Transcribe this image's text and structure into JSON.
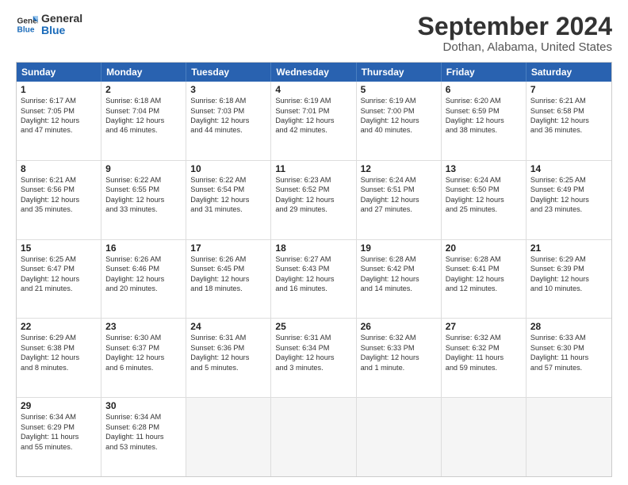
{
  "logo": {
    "line1": "General",
    "line2": "Blue"
  },
  "title": "September 2024",
  "subtitle": "Dothan, Alabama, United States",
  "days_of_week": [
    "Sunday",
    "Monday",
    "Tuesday",
    "Wednesday",
    "Thursday",
    "Friday",
    "Saturday"
  ],
  "weeks": [
    [
      {
        "num": "1",
        "lines": [
          "Sunrise: 6:17 AM",
          "Sunset: 7:05 PM",
          "Daylight: 12 hours",
          "and 47 minutes."
        ]
      },
      {
        "num": "2",
        "lines": [
          "Sunrise: 6:18 AM",
          "Sunset: 7:04 PM",
          "Daylight: 12 hours",
          "and 46 minutes."
        ]
      },
      {
        "num": "3",
        "lines": [
          "Sunrise: 6:18 AM",
          "Sunset: 7:03 PM",
          "Daylight: 12 hours",
          "and 44 minutes."
        ]
      },
      {
        "num": "4",
        "lines": [
          "Sunrise: 6:19 AM",
          "Sunset: 7:01 PM",
          "Daylight: 12 hours",
          "and 42 minutes."
        ]
      },
      {
        "num": "5",
        "lines": [
          "Sunrise: 6:19 AM",
          "Sunset: 7:00 PM",
          "Daylight: 12 hours",
          "and 40 minutes."
        ]
      },
      {
        "num": "6",
        "lines": [
          "Sunrise: 6:20 AM",
          "Sunset: 6:59 PM",
          "Daylight: 12 hours",
          "and 38 minutes."
        ]
      },
      {
        "num": "7",
        "lines": [
          "Sunrise: 6:21 AM",
          "Sunset: 6:58 PM",
          "Daylight: 12 hours",
          "and 36 minutes."
        ]
      }
    ],
    [
      {
        "num": "8",
        "lines": [
          "Sunrise: 6:21 AM",
          "Sunset: 6:56 PM",
          "Daylight: 12 hours",
          "and 35 minutes."
        ]
      },
      {
        "num": "9",
        "lines": [
          "Sunrise: 6:22 AM",
          "Sunset: 6:55 PM",
          "Daylight: 12 hours",
          "and 33 minutes."
        ]
      },
      {
        "num": "10",
        "lines": [
          "Sunrise: 6:22 AM",
          "Sunset: 6:54 PM",
          "Daylight: 12 hours",
          "and 31 minutes."
        ]
      },
      {
        "num": "11",
        "lines": [
          "Sunrise: 6:23 AM",
          "Sunset: 6:52 PM",
          "Daylight: 12 hours",
          "and 29 minutes."
        ]
      },
      {
        "num": "12",
        "lines": [
          "Sunrise: 6:24 AM",
          "Sunset: 6:51 PM",
          "Daylight: 12 hours",
          "and 27 minutes."
        ]
      },
      {
        "num": "13",
        "lines": [
          "Sunrise: 6:24 AM",
          "Sunset: 6:50 PM",
          "Daylight: 12 hours",
          "and 25 minutes."
        ]
      },
      {
        "num": "14",
        "lines": [
          "Sunrise: 6:25 AM",
          "Sunset: 6:49 PM",
          "Daylight: 12 hours",
          "and 23 minutes."
        ]
      }
    ],
    [
      {
        "num": "15",
        "lines": [
          "Sunrise: 6:25 AM",
          "Sunset: 6:47 PM",
          "Daylight: 12 hours",
          "and 21 minutes."
        ]
      },
      {
        "num": "16",
        "lines": [
          "Sunrise: 6:26 AM",
          "Sunset: 6:46 PM",
          "Daylight: 12 hours",
          "and 20 minutes."
        ]
      },
      {
        "num": "17",
        "lines": [
          "Sunrise: 6:26 AM",
          "Sunset: 6:45 PM",
          "Daylight: 12 hours",
          "and 18 minutes."
        ]
      },
      {
        "num": "18",
        "lines": [
          "Sunrise: 6:27 AM",
          "Sunset: 6:43 PM",
          "Daylight: 12 hours",
          "and 16 minutes."
        ]
      },
      {
        "num": "19",
        "lines": [
          "Sunrise: 6:28 AM",
          "Sunset: 6:42 PM",
          "Daylight: 12 hours",
          "and 14 minutes."
        ]
      },
      {
        "num": "20",
        "lines": [
          "Sunrise: 6:28 AM",
          "Sunset: 6:41 PM",
          "Daylight: 12 hours",
          "and 12 minutes."
        ]
      },
      {
        "num": "21",
        "lines": [
          "Sunrise: 6:29 AM",
          "Sunset: 6:39 PM",
          "Daylight: 12 hours",
          "and 10 minutes."
        ]
      }
    ],
    [
      {
        "num": "22",
        "lines": [
          "Sunrise: 6:29 AM",
          "Sunset: 6:38 PM",
          "Daylight: 12 hours",
          "and 8 minutes."
        ]
      },
      {
        "num": "23",
        "lines": [
          "Sunrise: 6:30 AM",
          "Sunset: 6:37 PM",
          "Daylight: 12 hours",
          "and 6 minutes."
        ]
      },
      {
        "num": "24",
        "lines": [
          "Sunrise: 6:31 AM",
          "Sunset: 6:36 PM",
          "Daylight: 12 hours",
          "and 5 minutes."
        ]
      },
      {
        "num": "25",
        "lines": [
          "Sunrise: 6:31 AM",
          "Sunset: 6:34 PM",
          "Daylight: 12 hours",
          "and 3 minutes."
        ]
      },
      {
        "num": "26",
        "lines": [
          "Sunrise: 6:32 AM",
          "Sunset: 6:33 PM",
          "Daylight: 12 hours",
          "and 1 minute."
        ]
      },
      {
        "num": "27",
        "lines": [
          "Sunrise: 6:32 AM",
          "Sunset: 6:32 PM",
          "Daylight: 11 hours",
          "and 59 minutes."
        ]
      },
      {
        "num": "28",
        "lines": [
          "Sunrise: 6:33 AM",
          "Sunset: 6:30 PM",
          "Daylight: 11 hours",
          "and 57 minutes."
        ]
      }
    ],
    [
      {
        "num": "29",
        "lines": [
          "Sunrise: 6:34 AM",
          "Sunset: 6:29 PM",
          "Daylight: 11 hours",
          "and 55 minutes."
        ]
      },
      {
        "num": "30",
        "lines": [
          "Sunrise: 6:34 AM",
          "Sunset: 6:28 PM",
          "Daylight: 11 hours",
          "and 53 minutes."
        ]
      },
      {
        "num": "",
        "lines": []
      },
      {
        "num": "",
        "lines": []
      },
      {
        "num": "",
        "lines": []
      },
      {
        "num": "",
        "lines": []
      },
      {
        "num": "",
        "lines": []
      }
    ]
  ]
}
